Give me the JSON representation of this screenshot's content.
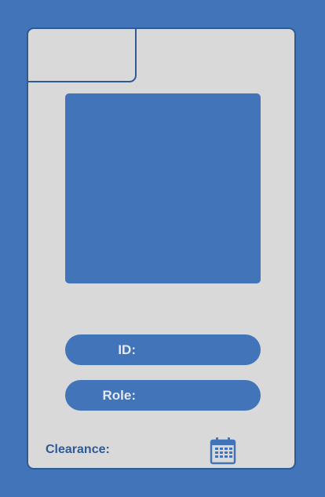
{
  "card": {
    "id_label": "ID:",
    "role_label": "Role:",
    "clearance_label": "Clearance:"
  },
  "colors": {
    "background": "#4174b8",
    "card": "#d9d9d9",
    "accent": "#2f5a93",
    "pill_text": "#e4e8ef"
  },
  "icons": {
    "calendar": "calendar-icon"
  }
}
